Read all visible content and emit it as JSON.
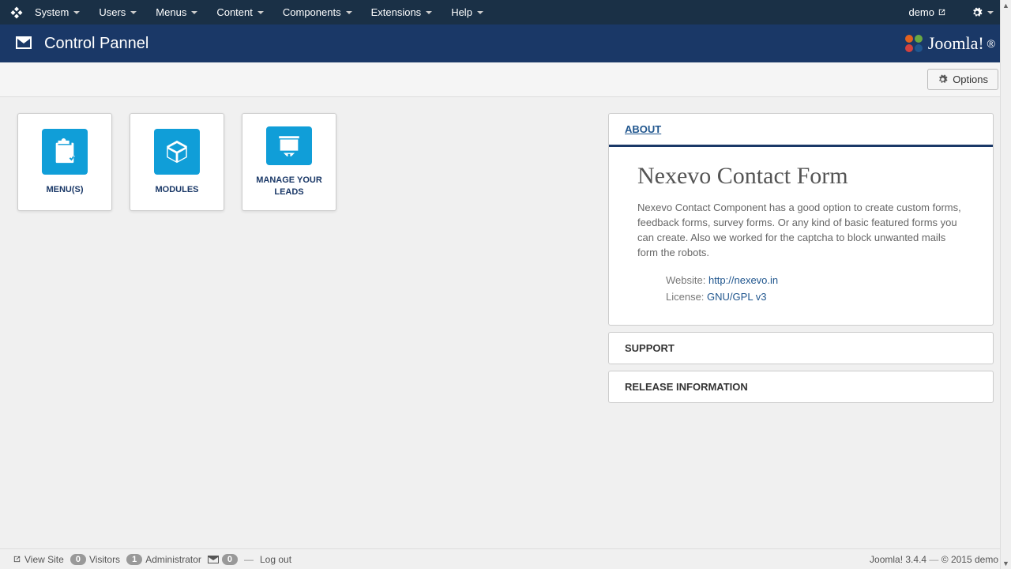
{
  "topnav": {
    "items": [
      "System",
      "Users",
      "Menus",
      "Content",
      "Components",
      "Extensions",
      "Help"
    ],
    "user": "demo"
  },
  "header": {
    "title": "Control Pannel",
    "brand": "Joomla!"
  },
  "toolbar": {
    "options_label": "Options"
  },
  "cards": [
    {
      "label": "MENU(S)"
    },
    {
      "label": "MODULES"
    },
    {
      "label": "MANAGE YOUR LEADS"
    }
  ],
  "panels": {
    "about": {
      "head": "ABOUT",
      "title": "Nexevo Contact Form",
      "desc": "Nexevo Contact Component has a good option to create custom forms, feedback forms, survey forms. Or any kind of basic featured forms you can create. Also we worked for the captcha to block unwanted mails form the robots.",
      "website_label": "Website:",
      "website_link": "http://nexevo.in",
      "license_label": "License:",
      "license_link": "GNU/GPL v3"
    },
    "support": {
      "head": "SUPPORT"
    },
    "release": {
      "head": "RELEASE INFORMATION"
    }
  },
  "footer": {
    "view_site": "View Site",
    "visitors_count": "0",
    "visitors_label": "Visitors",
    "admin_count": "1",
    "admin_label": "Administrator",
    "mail_count": "0",
    "logout": "Log out",
    "version": "Joomla! 3.4.4",
    "copyright": "© 2015 demo"
  }
}
